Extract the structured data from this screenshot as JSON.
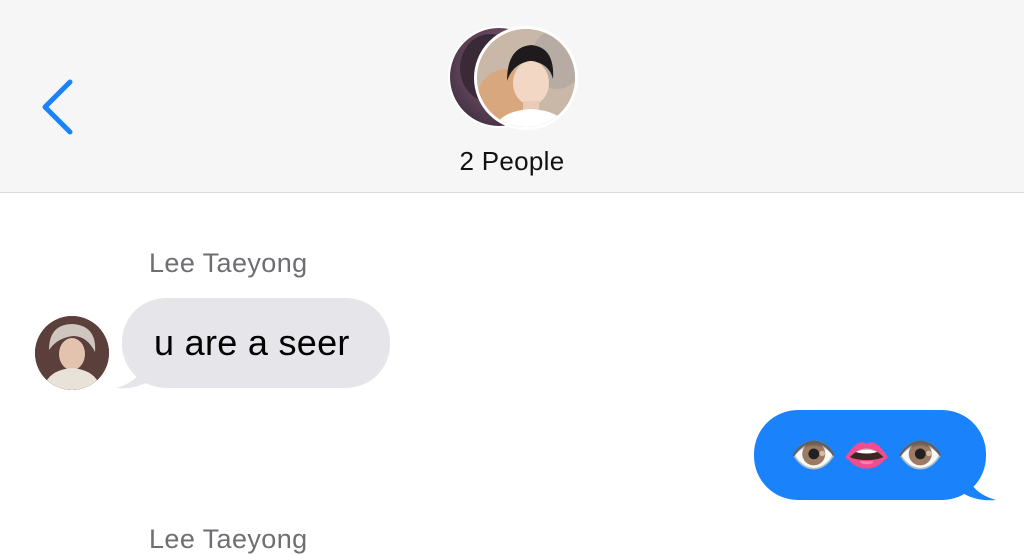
{
  "header": {
    "back_icon": "chevron-left-icon",
    "title": "2 People",
    "accent_color": "#1a82fb"
  },
  "conversation": {
    "messages": [
      {
        "direction": "incoming",
        "sender": "Lee Taeyong",
        "text": "u are a seer",
        "bubble_color": "#e5e5ea"
      },
      {
        "direction": "outgoing",
        "text": "👁️👄👁️",
        "bubble_color": "#1a82fb"
      }
    ],
    "next_sender_partial": "Lee Taeyong"
  }
}
